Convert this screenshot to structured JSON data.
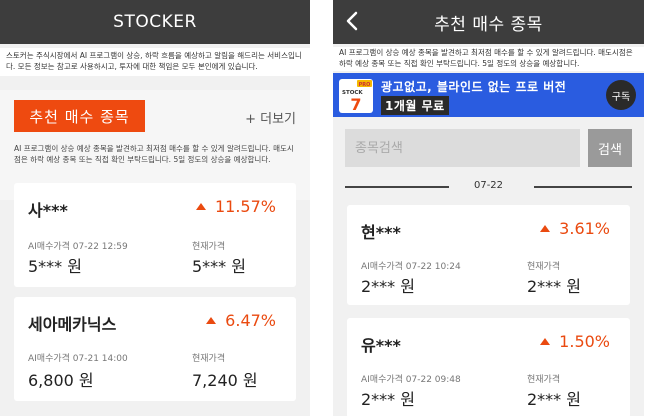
{
  "left": {
    "title": "STOCKER",
    "notice": "스토커는 주식시장에서 AI 프로그램이 상승, 하락 흐름을 예상하고 알림을 해드리는 서비스입니다. 모든 정보는 참고로 사용하시고, 투자에 대한 책임은 모두 본인에게 있습니다.",
    "reco_button": "추천 매수 종목",
    "more_link": "+ 더보기",
    "section_desc": "AI 프로그램이 상승 예상 종목을 발견하고 최저점 매수를 할 수 있게 알려드립니다. 매도시점은 하락 예상 종목 또는 직접 확인 부탁드립니다. 5일 정도의 상승을 예상합니다.",
    "cards": [
      {
        "name": "사***",
        "change": "11.57%",
        "buy_label": "AI매수가격 07-22 12:59",
        "buy_value": "5*** 원",
        "cur_label": "현재가격",
        "cur_value": "5*** 원"
      },
      {
        "name": "세아메카닉스",
        "change": "6.47%",
        "buy_label": "AI매수가격 07-21 14:00",
        "buy_value": "6,800 원",
        "cur_label": "현재가격",
        "cur_value": "7,240 원"
      }
    ]
  },
  "right": {
    "title": "추천 매수 종목",
    "notice": "AI 프로그램이 상승 예상 종목을 발견하고 최저점 매수를 할 수 있게 알려드립니다. 매도시점은 하락 예상 종목 또는 직접 확인 부탁드립니다. 5일 정도의 상승을 예상합니다.",
    "promo": {
      "line1": "광고없고, 블라인드 없는 프로 버전",
      "line2": "1개월 무료",
      "subscribe": "구독",
      "logo_text": "STOCK",
      "logo_badge": "PRO",
      "logo_num": "7"
    },
    "search": {
      "placeholder": "종목검색",
      "button": "검색"
    },
    "date_separator": "07-22",
    "cards": [
      {
        "name": "현***",
        "change": "3.61%",
        "buy_label": "AI매수가격 07-22 10:24",
        "buy_value": "2*** 원",
        "cur_label": "현재가격",
        "cur_value": "2*** 원"
      },
      {
        "name": "유***",
        "change": "1.50%",
        "buy_label": "AI매수가격 07-22 09:48",
        "buy_value": "2*** 원",
        "cur_label": "현재가격",
        "cur_value": "2*** 원"
      }
    ]
  },
  "colors": {
    "accent": "#ee4a10",
    "promo": "#2a5ce0",
    "topbar": "#3d3d3d"
  }
}
